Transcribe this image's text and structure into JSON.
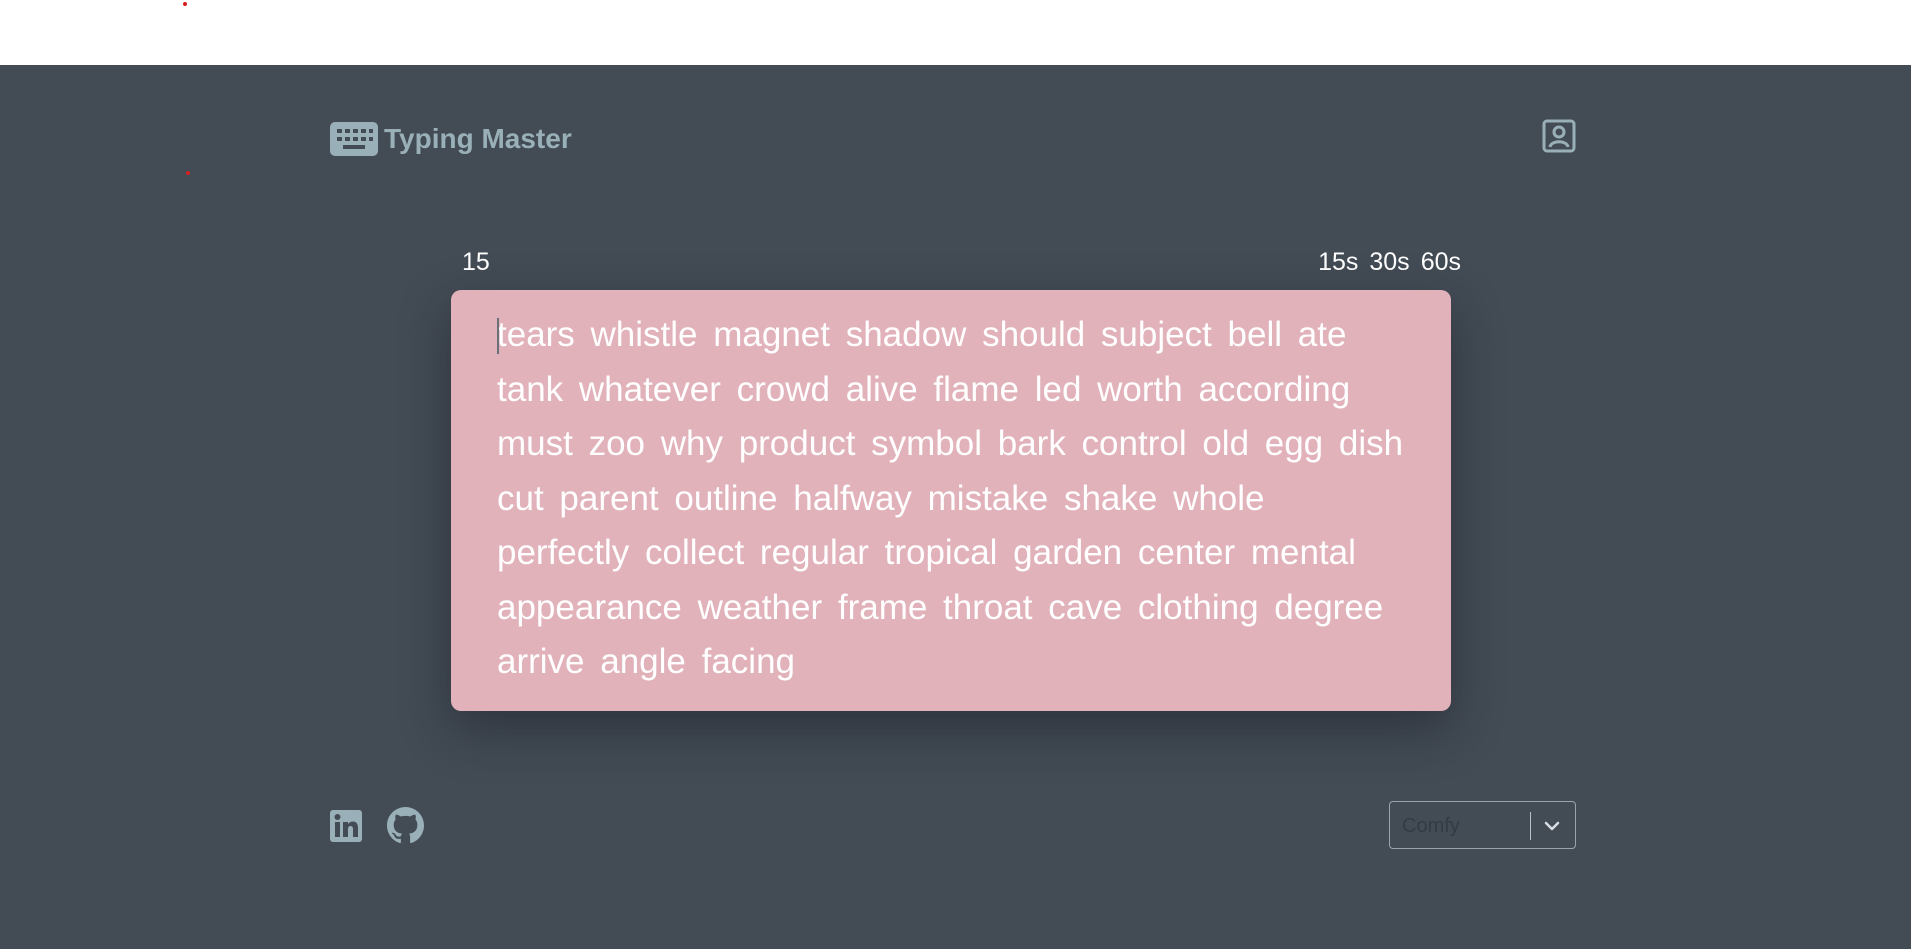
{
  "app": {
    "title": "Typing Master",
    "brand_icon": "keyboard-icon",
    "profile_icon": "user-profile-icon"
  },
  "test": {
    "counter": "15",
    "modes": [
      "15s",
      "30s",
      "60s"
    ]
  },
  "words": "tears whistle magnet shadow should subject bell ate tank whatever crowd alive flame led worth according must zoo why product symbol bark control old egg dish cut parent outline halfway mistake shake whole perfectly collect regular tropical garden center mental appearance weather frame throat cave clothing degree arrive angle facing",
  "footer": {
    "links": [
      "linkedin-icon",
      "github-icon"
    ],
    "theme_select": {
      "value": "Comfy"
    }
  },
  "colors": {
    "background": "#434b55",
    "card": "#e2b2bb",
    "brand_text": "#9ab0b9",
    "text": "#ffffff"
  }
}
